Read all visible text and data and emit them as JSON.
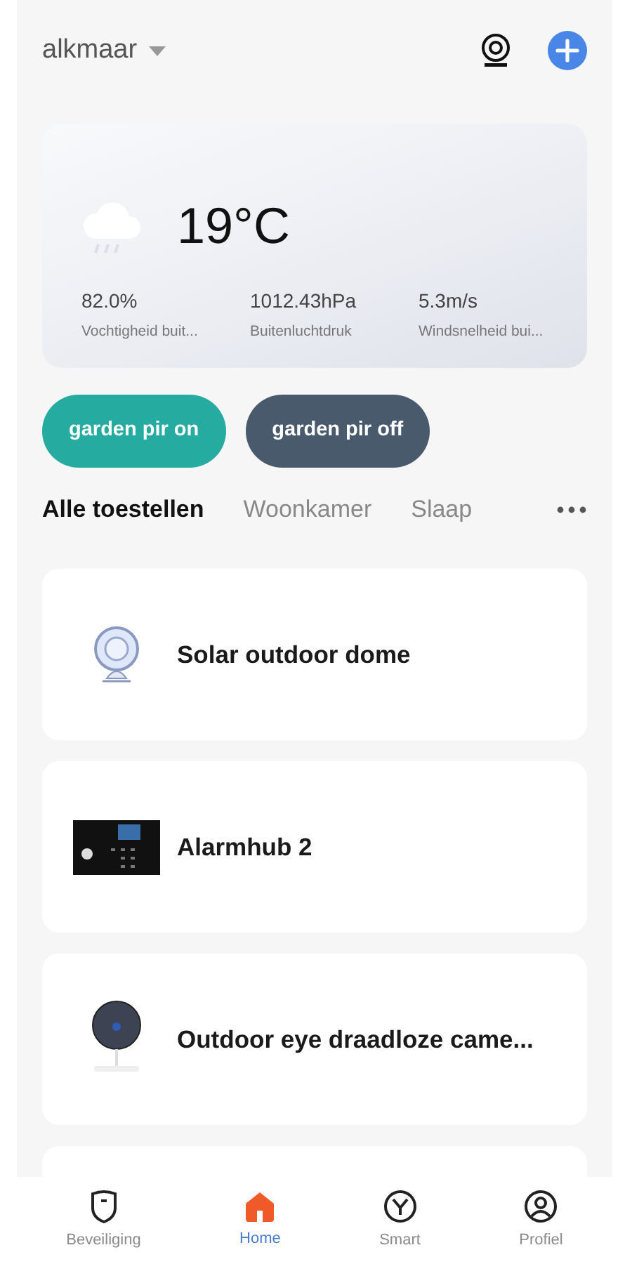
{
  "header": {
    "home_name": "alkmaar"
  },
  "weather": {
    "temperature": "19°C",
    "stats": [
      {
        "value": "82.0%",
        "label": "Vochtigheid buit..."
      },
      {
        "value": "1012.43hPa",
        "label": "Buitenluchtdruk"
      },
      {
        "value": "5.3m/s",
        "label": "Windsnelheid bui..."
      }
    ]
  },
  "scenes": [
    {
      "label": "garden pir on",
      "color": "#25ab9f"
    },
    {
      "label": "garden pir off",
      "color": "#4a5a6d"
    }
  ],
  "room_tabs": [
    {
      "label": "Alle toestellen",
      "selected": true
    },
    {
      "label": "Woonkamer",
      "selected": false
    },
    {
      "label": "Slaap",
      "selected": false
    }
  ],
  "devices": [
    {
      "name": "Solar outdoor dome",
      "kind": "dome"
    },
    {
      "name": "Alarmhub 2",
      "kind": "hub"
    },
    {
      "name": "Outdoor eye draadloze came...",
      "kind": "eye"
    }
  ],
  "bottom_nav": [
    {
      "label": "Beveiliging",
      "kind": "shield",
      "selected": false
    },
    {
      "label": "Home",
      "kind": "home",
      "selected": true
    },
    {
      "label": "Smart",
      "kind": "smart",
      "selected": false
    },
    {
      "label": "Profiel",
      "kind": "profile",
      "selected": false
    }
  ]
}
